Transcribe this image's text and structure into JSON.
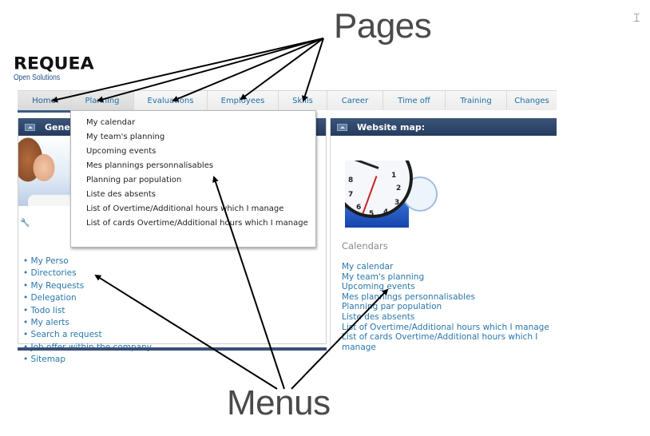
{
  "logo": {
    "name": "REQUEA",
    "tagline": "Open Solutions"
  },
  "nav": {
    "tabs": [
      {
        "label": "Home",
        "state": "active"
      },
      {
        "label": "Planning",
        "state": "open"
      },
      {
        "label": "Evaluations"
      },
      {
        "label": "Employees"
      },
      {
        "label": "Skills"
      },
      {
        "label": "Career"
      },
      {
        "label": "Time off"
      },
      {
        "label": "Training"
      },
      {
        "label": "Changes"
      }
    ]
  },
  "planning_menu": {
    "items": [
      "My calendar",
      "My team's planning",
      "Upcoming events",
      "Mes plannings personnalisables",
      "Planning par population",
      "Liste des absents",
      "List of Overtime/Additional hours which I manage",
      "List of cards Overtime/Additional hours which I manage"
    ]
  },
  "left_panel": {
    "title": "Gener",
    "links": [
      "My Perso",
      "Directories",
      "My Requests",
      "Delegation",
      "Todo list",
      "My alerts",
      "Search a request",
      "Job offer within the company",
      "Sitemap"
    ]
  },
  "right_panel": {
    "title": "Website map:",
    "section_title": "Calendars",
    "links": [
      "My calendar",
      "My team's planning",
      "Upcoming events",
      "Mes plannings personnalisables",
      "Planning par population",
      "Liste des absents",
      "List of Overtime/Additional hours which I manage",
      "List of cards Overtime/Additional hours which I manage"
    ]
  },
  "annotations": {
    "pages": "Pages",
    "menus": "Menus"
  },
  "colors": {
    "link": "#2a77ad",
    "header_bg": "#263b5e",
    "annotation": "#4a4a4a"
  }
}
